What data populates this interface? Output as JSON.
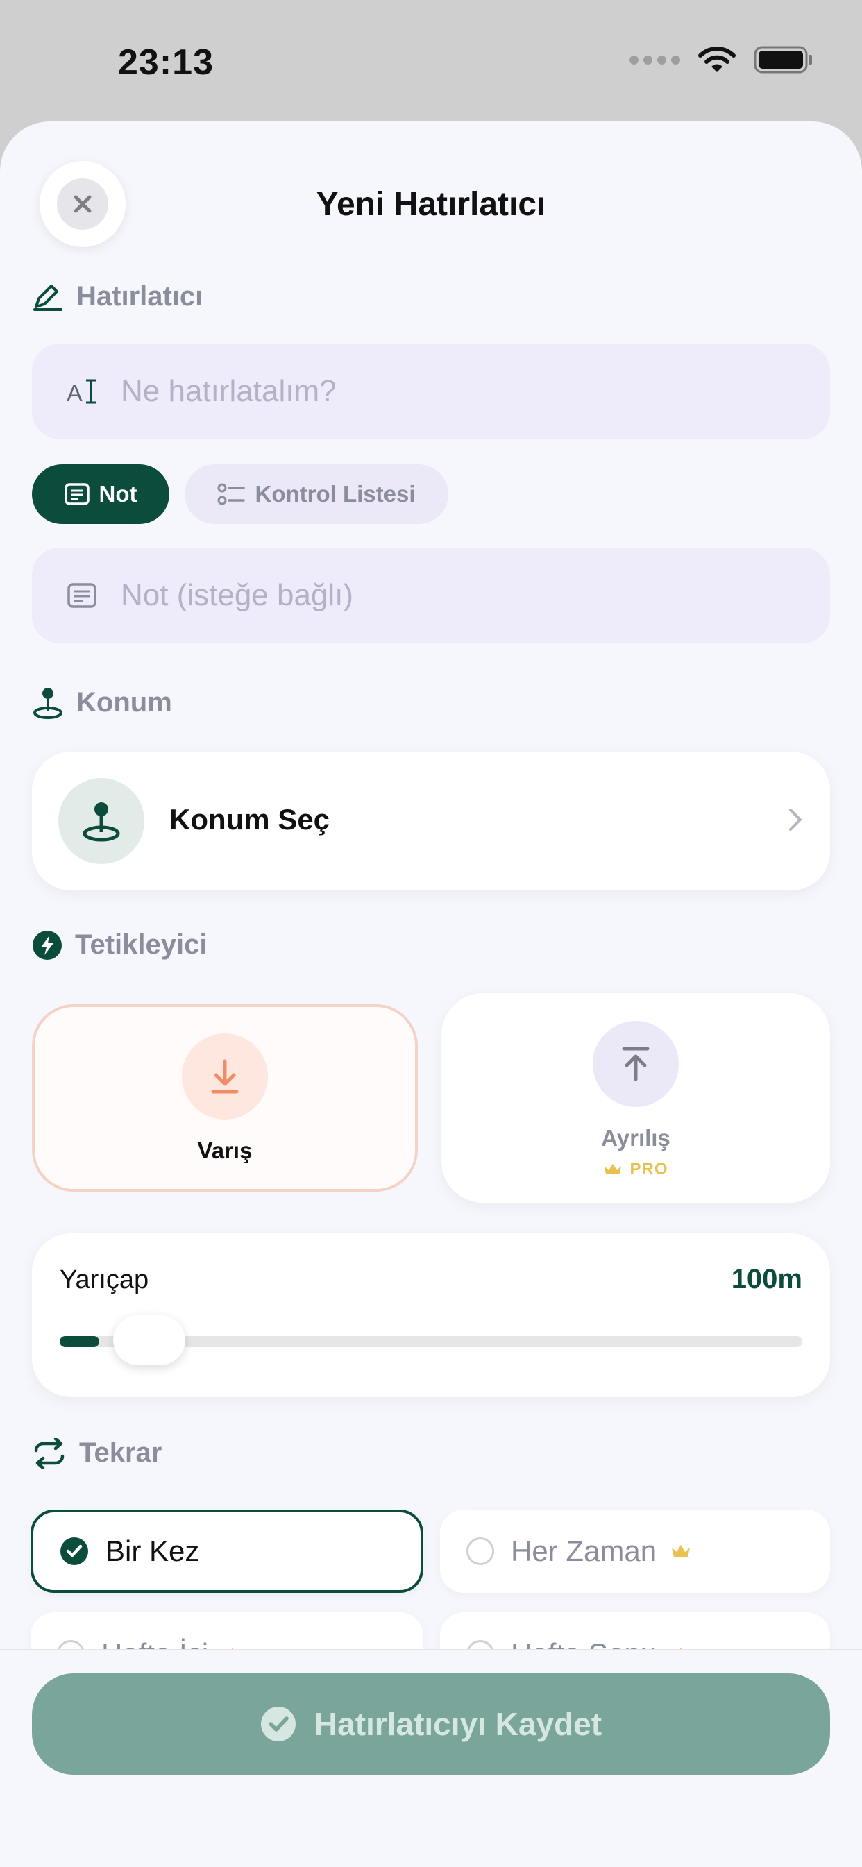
{
  "status_bar": {
    "time": "23:13"
  },
  "sheet": {
    "title": "Yeni Hatırlatıcı",
    "close_icon": "close-icon"
  },
  "reminder_section": {
    "label": "Hatırlatıcı",
    "title_input_placeholder": "Ne hatırlatalım?",
    "type_chips": [
      {
        "label": "Not",
        "selected": true
      },
      {
        "label": "Kontrol Listesi",
        "selected": false
      }
    ],
    "note_input_placeholder": "Not (isteğe bağlı)"
  },
  "location_section": {
    "label": "Konum",
    "select_label": "Konum Seç"
  },
  "trigger_section": {
    "label": "Tetikleyici",
    "options": [
      {
        "label": "Varış",
        "selected": true
      },
      {
        "label": "Ayrılış",
        "badge": "PRO",
        "selected": false
      }
    ]
  },
  "radius": {
    "label": "Yarıçap",
    "value": "100m",
    "slider_fraction": 0.05
  },
  "repeat_section": {
    "label": "Tekrar",
    "options": [
      {
        "label": "Bir Kez",
        "selected": true,
        "pro": false
      },
      {
        "label": "Her Zaman",
        "selected": false,
        "pro": true
      },
      {
        "label": "Hafta İçi",
        "selected": false,
        "pro": true
      },
      {
        "label": "Hafta Sonu",
        "selected": false,
        "pro": true
      }
    ]
  },
  "save_button": {
    "label": "Hatırlatıcıyı Kaydet",
    "enabled": false
  },
  "colors": {
    "primary": "#0b4c3d",
    "arrival_accent": "#f08c66",
    "pro_gold": "#e8c14f",
    "save_disabled": "#7aa59a"
  }
}
